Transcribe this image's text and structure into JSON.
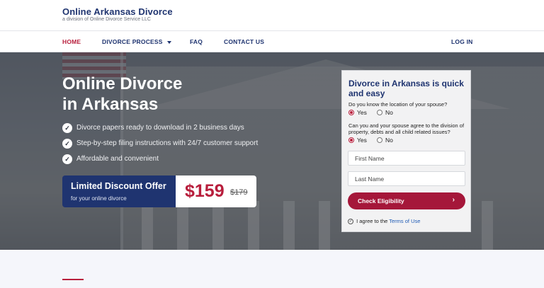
{
  "brand": {
    "title": "Online Arkansas Divorce",
    "subtitle": "a division of Online Divorce Service LLC"
  },
  "nav": {
    "items": [
      {
        "label": "HOME"
      },
      {
        "label": "DIVORCE PROCESS"
      },
      {
        "label": "FAQ"
      },
      {
        "label": "CONTACT US"
      }
    ],
    "login_label": "LOG IN"
  },
  "hero": {
    "title_line1": "Online Divorce",
    "title_line2": "in Arkansas",
    "bullets": [
      "Divorce papers ready to download in 2 business days",
      "Step-by-step filing instructions with 24/7 customer support",
      "Affordable and convenient"
    ],
    "offer": {
      "title": "Limited Discount Offer",
      "subtitle": "for your online divorce",
      "price": "$159",
      "old_price": "$179"
    }
  },
  "form": {
    "title": "Divorce in Arkansas is quick and easy",
    "q1": {
      "text": "Do you know the location of your spouse?",
      "yes": "Yes",
      "no": "No",
      "selected": "Yes"
    },
    "q2": {
      "text": "Can you and your spouse agree to the division of property, debts and all child related issues?",
      "yes": "Yes",
      "no": "No",
      "selected": "Yes"
    },
    "first_name_placeholder": "First Name",
    "last_name_placeholder": "Last Name",
    "button_label": "Check Eligibility",
    "terms_prefix": "I agree to the",
    "terms_link": "Terms of Use"
  },
  "colors": {
    "brand_navy": "#1f3470",
    "accent_red": "#b81e3c"
  },
  "icons": {
    "bullet": "check-circle-icon",
    "dropdown": "caret-down-icon",
    "button": "chevron-right-icon",
    "terms": "check-circle-outline-icon"
  }
}
